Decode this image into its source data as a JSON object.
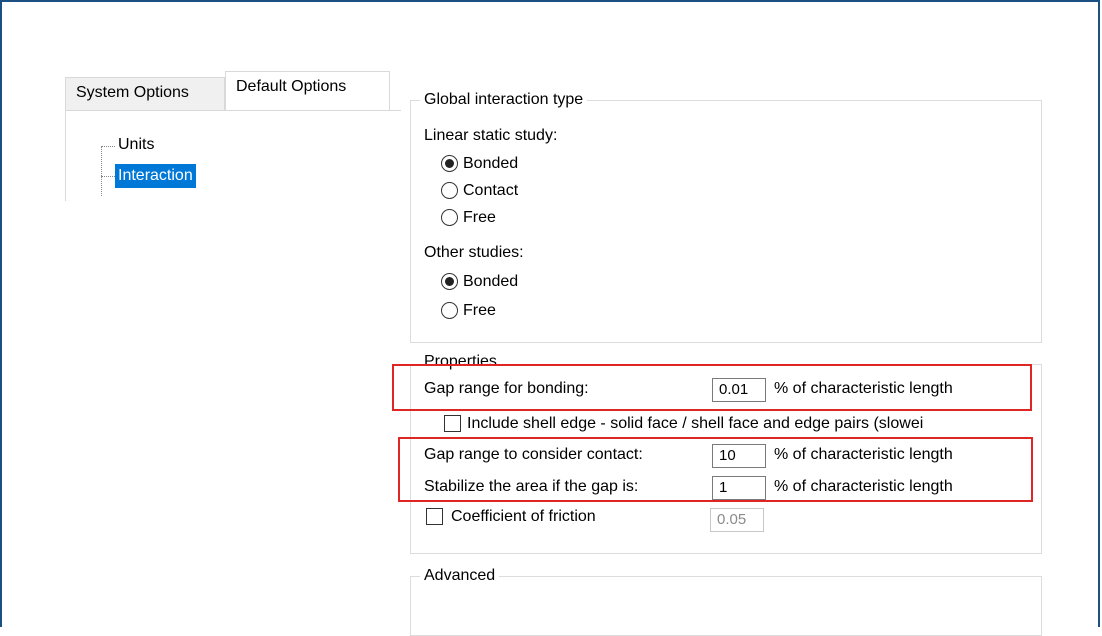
{
  "tabs": {
    "system": "System Options",
    "default": "Default Options"
  },
  "tree": {
    "units": "Units",
    "interaction": "Interaction"
  },
  "global": {
    "legend": "Global interaction type",
    "linear_label": "Linear static study:",
    "linear_options": [
      "Bonded",
      "Contact",
      "Free"
    ],
    "linear_selected": "Bonded",
    "other_label": "Other studies:",
    "other_options": [
      "Bonded",
      "Free"
    ],
    "other_selected": "Bonded"
  },
  "properties": {
    "legend": "Properties",
    "gap_bonding_label": "Gap range for bonding:",
    "gap_bonding_value": "0.01",
    "unit_text": "% of characteristic length",
    "include_shell_label": "Include shell edge - solid face / shell face and edge pairs (slowei",
    "gap_contact_label": "Gap range to consider contact:",
    "gap_contact_value": "10",
    "stabilize_label": "Stabilize the area if the gap is:",
    "stabilize_value": "1",
    "friction_label": "Coefficient of friction",
    "friction_value": "0.05"
  },
  "advanced": {
    "legend": "Advanced"
  },
  "colors": {
    "highlight": "#e02525",
    "selection": "#0078d7",
    "frame": "#1c4f82"
  }
}
